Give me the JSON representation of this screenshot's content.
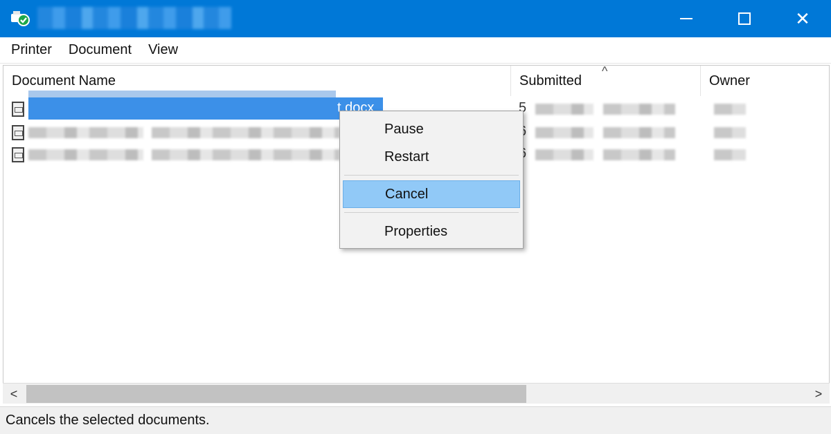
{
  "window": {
    "title": "",
    "minimize_glyph": "",
    "maximize_glyph": "",
    "close_glyph": "✕"
  },
  "menubar": {
    "items": [
      {
        "label": "Printer"
      },
      {
        "label": "Document"
      },
      {
        "label": "View"
      }
    ]
  },
  "columns": [
    {
      "label": "Document Name"
    },
    {
      "label": "Submitted"
    },
    {
      "label": "Owner"
    }
  ],
  "sort_indicator": "^",
  "rows": [
    {
      "name_visible": "t.docx",
      "submitted_visible": "5",
      "selected": true
    },
    {
      "name_visible": "",
      "submitted_visible": "6",
      "selected": false
    },
    {
      "name_visible": "",
      "submitted_visible": "6",
      "selected": false
    }
  ],
  "context_menu": {
    "items": [
      {
        "label": "Pause"
      },
      {
        "label": "Restart"
      },
      {
        "label": "Cancel",
        "highlighted": true
      },
      {
        "label": "Properties"
      }
    ]
  },
  "scrollbar": {
    "left_arrow": "<",
    "right_arrow": ">"
  },
  "status": {
    "text": "Cancels the selected documents."
  },
  "colors": {
    "titlebar": "#0078d7",
    "selection": "#3c90e8",
    "menu_highlight": "#91c9f7"
  }
}
